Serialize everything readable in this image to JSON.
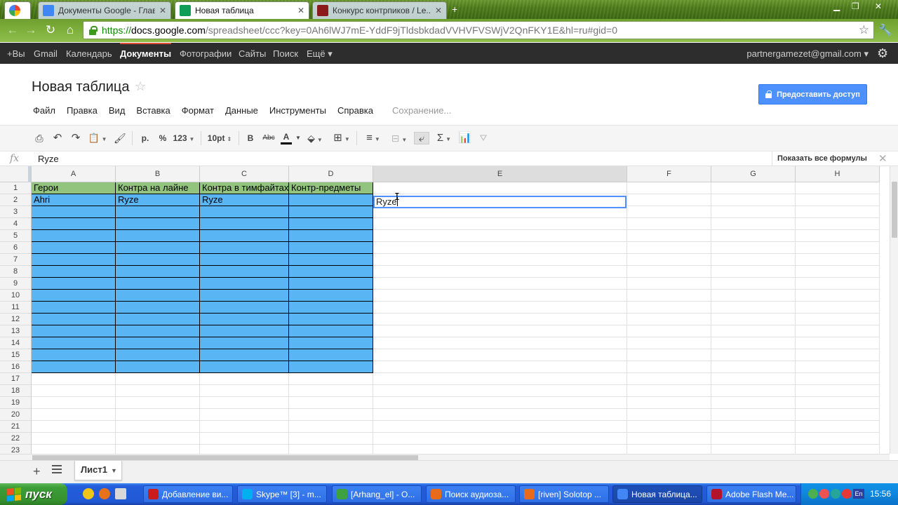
{
  "browser": {
    "tabs": [
      {
        "title": "Документы Google - Глав...",
        "favicon_color": "#4285f4"
      },
      {
        "title": "Новая таблица",
        "favicon_color": "#0f9d58",
        "active": true
      },
      {
        "title": "Конкурс контрпиков / Le...",
        "favicon_color": "#8b1a1a"
      }
    ],
    "new_tab_symbol": "+",
    "url_scheme": "https://",
    "url_host": "docs.google.com",
    "url_rest": "/spreadsheet/ccc?key=0Ah6lWJ7mE-YddF9jTldsbkdadVVHVFVSWjV2QnFKY1E&hl=ru#gid=0"
  },
  "gbar": {
    "items": [
      "+Вы",
      "Gmail",
      "Календарь",
      "Документы",
      "Фотографии",
      "Сайты",
      "Поиск",
      "Ещё ▾"
    ],
    "active_item": "Документы",
    "account": "partnergamezet@gmail.com ▾"
  },
  "doc": {
    "title": "Новая таблица",
    "share_label": "Предоставить доступ",
    "menu": [
      "Файл",
      "Правка",
      "Вид",
      "Вставка",
      "Формат",
      "Данные",
      "Инструменты",
      "Справка"
    ],
    "status": "Сохранение..."
  },
  "toolbar": {
    "currency": "р.",
    "percent": "%",
    "number_format": "123",
    "font_size": "10pt",
    "bold": "B",
    "strike": "Abc",
    "text_color_letter": "A"
  },
  "formula_bar": {
    "fx_label": "fx",
    "value": "Ryze",
    "show_formulas_label": "Показать все формулы"
  },
  "sheet": {
    "columns": [
      "A",
      "B",
      "C",
      "D",
      "E",
      "F",
      "G",
      "H"
    ],
    "selected_column": "E",
    "row_numbers": [
      "1",
      "2",
      "3",
      "4",
      "5",
      "6",
      "7",
      "8",
      "9",
      "10",
      "11",
      "12",
      "13",
      "14",
      "15",
      "16",
      "17",
      "18",
      "19",
      "20",
      "21",
      "22",
      "23"
    ],
    "header_row": [
      "Герои",
      "Контра на лайне",
      "Контра в тимфайтах",
      "Контр-предметы"
    ],
    "row2": [
      "Ahri",
      "Ryze",
      "Ryze",
      ""
    ],
    "editing_cell": {
      "ref": "E2",
      "value": "Ryze"
    },
    "header_color": "#93c47d",
    "fill_color": "#5ab5f5",
    "sheet_tab": "Лист1"
  },
  "taskbar": {
    "start_label": "пуск",
    "buttons": [
      {
        "label": "Добавление ви...",
        "color": "#cc1b1b"
      },
      {
        "label": "Skype™ [3] - m...",
        "color": "#00aff0"
      },
      {
        "label": "[Arhang_el] - O...",
        "color": "#3ea33e"
      },
      {
        "label": "Поиск аудиоза...",
        "color": "#e86a1b"
      },
      {
        "label": "[riven] Solotop ...",
        "color": "#e86a1b"
      },
      {
        "label": "Новая таблица...",
        "color": "#4285f4",
        "active": true
      },
      {
        "label": "Adobe Flash Me...",
        "color": "#b3132d"
      }
    ],
    "lang": "En",
    "clock": "15:56"
  }
}
